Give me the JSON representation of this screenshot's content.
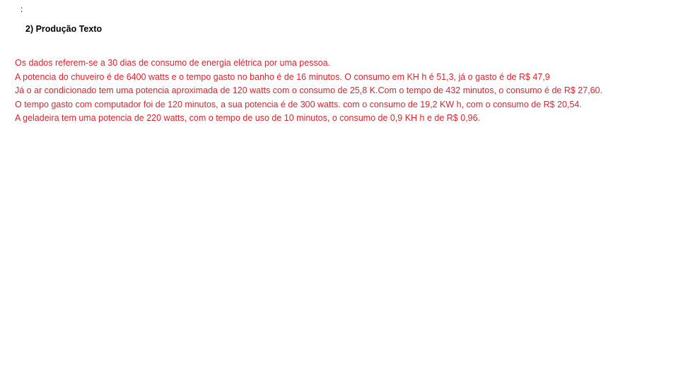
{
  "document": {
    "mark": ":",
    "heading": "2) Produção Texto",
    "text_color": "#e8202a",
    "paragraphs": [
      "Os dados referem-se a 30 dias de consumo de energia elétrica por uma pessoa.",
      "A potencia do chuveiro é de 6400 watts e o tempo gasto no banho é de 16 minutos. O consumo em KH h é 51,3, já o gasto é de R$ 47,9",
      "Já o ar condicionado tem uma potencia aproximada de 120 watts com o consumo de 25,8 K.Com o tempo de 432 minutos, o consumo é de R$ 27,60.",
      "O tempo gasto com computador foi de 120 minutos, a sua potencia é de 300 watts. com o consumo de 19,2 KW h, com o consumo de R$ 20,54.",
      "A geladeira tem uma potencia de 220 watts, com o tempo de uso de 10 minutos, o consumo de 0,9 KH h e de R$ 0,96."
    ]
  }
}
